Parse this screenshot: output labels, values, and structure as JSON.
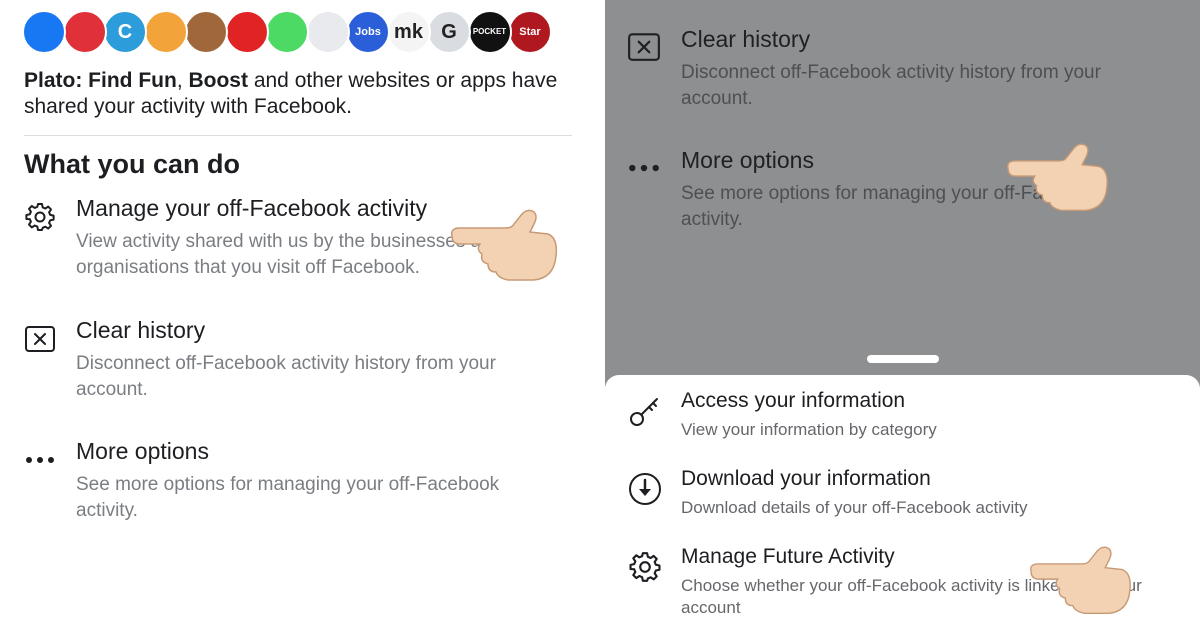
{
  "left_panel": {
    "app_icons": [
      {
        "name": "plato-app-icon",
        "color": "#1877f2",
        "text": ""
      },
      {
        "name": "heart-app-icon",
        "color": "#e0313b",
        "text": ""
      },
      {
        "name": "c-app-icon",
        "color": "#2d9cdb",
        "text": "C"
      },
      {
        "name": "bird-app-icon",
        "color": "#f2a33a",
        "text": ""
      },
      {
        "name": "person-app-icon",
        "color": "#a0683a",
        "text": ""
      },
      {
        "name": "red-character-app-icon",
        "color": "#e02424",
        "text": ""
      },
      {
        "name": "green-app-icon",
        "color": "#4cd964",
        "text": ""
      },
      {
        "name": "logo-app-icon",
        "color": "#e8eaed",
        "text": ""
      },
      {
        "name": "jobs-app-icon",
        "color": "#2b5fd9",
        "text": "Jobs"
      },
      {
        "name": "mk-app-icon",
        "color": "#f4f4f4",
        "text": "mk"
      },
      {
        "name": "classics-app-icon",
        "color": "#d9dce0",
        "text": "G"
      },
      {
        "name": "pocket-app-icon",
        "color": "#111111",
        "text": "POCKET"
      },
      {
        "name": "red-brand-app-icon",
        "color": "#b01820",
        "text": "Star"
      }
    ],
    "shared_text": {
      "bold_1": "Plato: Find Fun",
      "sep": ", ",
      "bold_2": "Boost",
      "rest": " and other websites or apps have shared your activity with Facebook."
    },
    "section_title": "What you can do",
    "options": [
      {
        "title": "Manage your off-Facebook activity",
        "desc": "View activity shared with us by the businesses and organisations that you visit off Facebook."
      },
      {
        "title": "Clear history",
        "desc": "Disconnect off-Facebook activity history from your account."
      },
      {
        "title": "More options",
        "desc": "See more options for managing your off-Facebook activity."
      }
    ]
  },
  "right_panel": {
    "options": [
      {
        "title": "Clear history",
        "desc": "Disconnect off-Facebook activity history from your account."
      },
      {
        "title": "More options",
        "desc": "See more options for managing your off-Facebook activity."
      }
    ],
    "sheet_items": [
      {
        "title": "Access your information",
        "desc": "View your information by category"
      },
      {
        "title": "Download your information",
        "desc": "Download details of your off-Facebook activity"
      },
      {
        "title": "Manage Future Activity",
        "desc": "Choose whether your off-Facebook activity is linked with your account"
      }
    ]
  },
  "colors": {
    "overlay_gray": "#8e8f91",
    "primary_text": "#1c1e21",
    "secondary_text": "#7a7d82",
    "skin": "#f3d2b4"
  }
}
